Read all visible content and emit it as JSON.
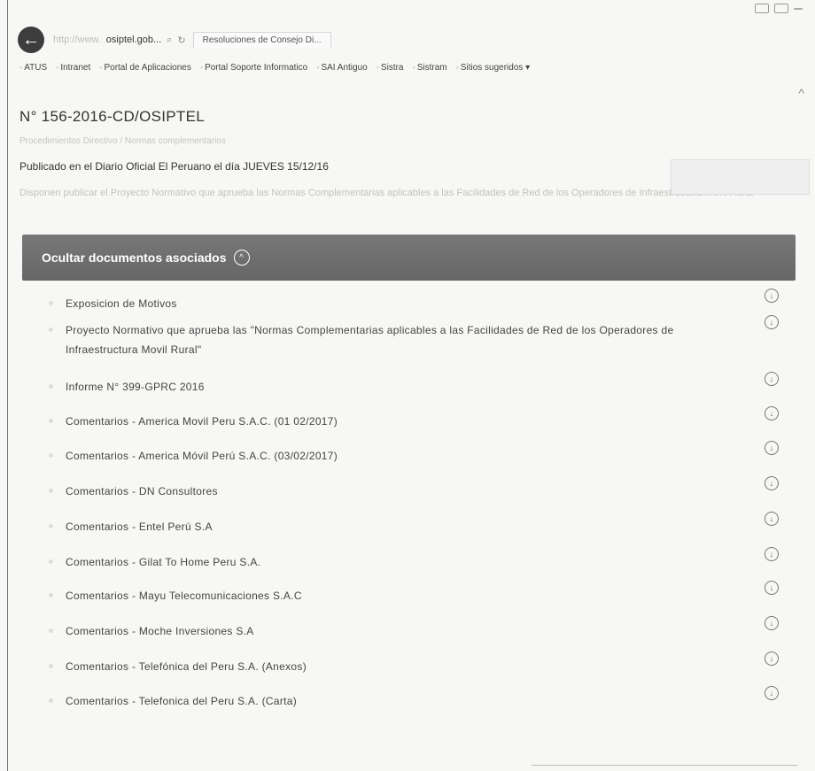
{
  "window": {
    "top_right_label": ""
  },
  "address_bar": {
    "url_prefix": "http://www.",
    "url_domain": "osiptel.gob...",
    "search_glyph": "⌕",
    "refresh_glyph": "↻",
    "tab_label": "Resoluciones de Consejo Di..."
  },
  "bookmarks": [
    {
      "label": "ATUS"
    },
    {
      "label": "Intranet"
    },
    {
      "label": "Portal de Aplicaciones"
    },
    {
      "label": "Portal Soporte Informatico"
    },
    {
      "label": "SAI Antiguo"
    },
    {
      "label": "Sistra"
    },
    {
      "label": "Sistram"
    },
    {
      "label": "Sitios sugeridos ▾"
    }
  ],
  "page": {
    "title": "N° 156-2016-CD/OSIPTEL",
    "breadcrumb": "Procedimientos Directivo / Normas complementarios",
    "published": "Publicado en el Diario Oficial El Peruano el día JUEVES 15/12/16",
    "description": "Disponen publicar el Proyecto Normativo que aprueba las Normas Complementarias aplicables a las Facilidades de Red de los Operadores de Infraestructura Movil Rural",
    "toggle_label": "Ocultar documentos asociados"
  },
  "documents": [
    {
      "label": "Exposicion de Motivos"
    },
    {
      "label": "Proyecto Normativo que aprueba las \"Normas Complementarias aplicables a las Facilidades de Red de los Operadores de Infraestructura Movil Rural\""
    },
    {
      "label": "Informe N° 399-GPRC 2016"
    },
    {
      "label": "Comentarios - America Movil Peru S.A.C. (01 02/2017)"
    },
    {
      "label": "Comentarios - America Móvil Perú S.A.C. (03/02/2017)"
    },
    {
      "label": "Comentarios - DN Consultores"
    },
    {
      "label": "Comentarios - Entel Perú S.A"
    },
    {
      "label": "Comentarios - Gilat To Home Peru S.A."
    },
    {
      "label": "Comentarios - Mayu Telecomunicaciones S.A.C"
    },
    {
      "label": "Comentarios - Moche Inversiones S.A"
    },
    {
      "label": "Comentarios - Telefónica del Peru S.A. (Anexos)"
    },
    {
      "label": "Comentarios - Telefonica del Peru S.A. (Carta)"
    }
  ],
  "icons": {
    "back": "back-arrow-icon",
    "download": "download-icon",
    "toggle": "chevron-up-icon"
  }
}
